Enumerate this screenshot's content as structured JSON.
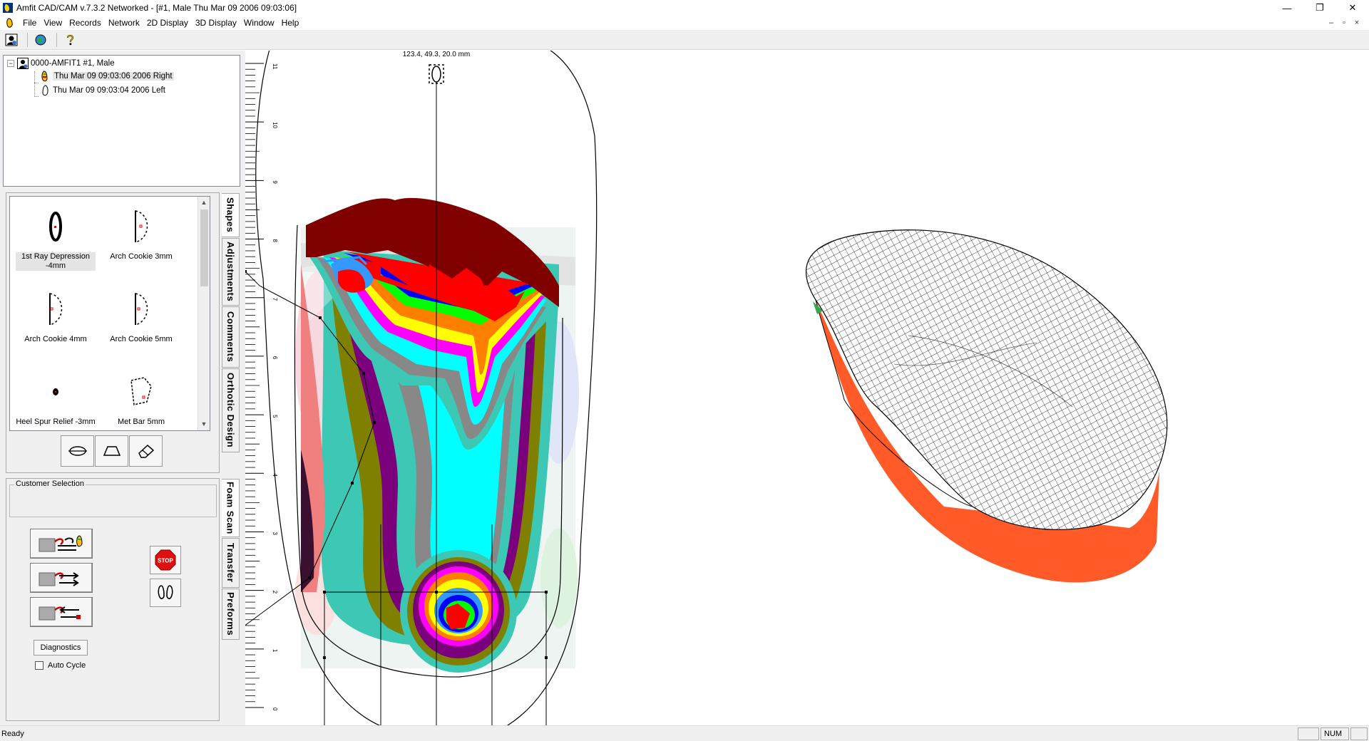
{
  "window": {
    "title": "Amfit CAD/CAM v.7.3.2 Networked - [#1, Male  Thu Mar 09 2006 09:03:06]",
    "minimize_glyph": "—",
    "restore_glyph": "❐",
    "close_glyph": "✕"
  },
  "menu": {
    "items": [
      "File",
      "View",
      "Records",
      "Network",
      "2D Display",
      "3D Display",
      "Window",
      "Help"
    ],
    "mdi_buttons": [
      "–",
      "▫",
      "×"
    ]
  },
  "toolbar": {
    "icons": [
      "patient-icon",
      "network-globe-icon",
      "help-icon"
    ]
  },
  "tree": {
    "root": "0000-AMFIT1  #1, Male",
    "children": [
      {
        "label": "Thu Mar 09 09:03:06 2006 Right",
        "selected": true
      },
      {
        "label": "Thu Mar 09 09:03:04 2006 Left",
        "selected": false
      }
    ]
  },
  "tabs": {
    "upper": [
      "Shapes",
      "Adjustments",
      "Comments",
      "Orthotic Design"
    ],
    "lower": [
      "Foam Scan",
      "Transfer",
      "Preforms"
    ],
    "active_upper": "Shapes",
    "active_lower": "Foam Scan"
  },
  "shapes": {
    "items": [
      {
        "label": "1st Ray Depression -4mm",
        "icon": "ray-depression-icon",
        "selected": true
      },
      {
        "label": "Arch Cookie 3mm",
        "icon": "arch-cookie-icon",
        "selected": false
      },
      {
        "label": "Arch Cookie 4mm",
        "icon": "arch-cookie-icon",
        "selected": false
      },
      {
        "label": "Arch Cookie 5mm",
        "icon": "arch-cookie-icon",
        "selected": false
      },
      {
        "label": "Heel Spur Relief -3mm",
        "icon": "heel-spur-icon",
        "selected": false
      },
      {
        "label": "Met Bar 5mm",
        "icon": "met-bar-icon",
        "selected": false
      }
    ],
    "tools": [
      "ellipse-tool-icon",
      "trapezoid-tool-icon",
      "eraser-tool-icon"
    ]
  },
  "foam_scan": {
    "group_label": "Customer Selection",
    "diagnostics_label": "Diagnostics",
    "auto_cycle_label": "Auto Cycle",
    "auto_cycle_checked": false,
    "stop_label": "STOP"
  },
  "view2d": {
    "coordinate_readout": "123.4, 49.3, 20.0 mm",
    "ruler_labels": [
      "11",
      "10",
      "9",
      "8",
      "7",
      "6",
      "5",
      "4",
      "3",
      "2",
      "1",
      "0"
    ]
  },
  "status": {
    "text": "Ready",
    "num": "NUM"
  },
  "colors": {
    "orthotic_base": "#ff5a28",
    "selection": "#e5e5e5",
    "panel_bg": "#f0f0f0"
  }
}
